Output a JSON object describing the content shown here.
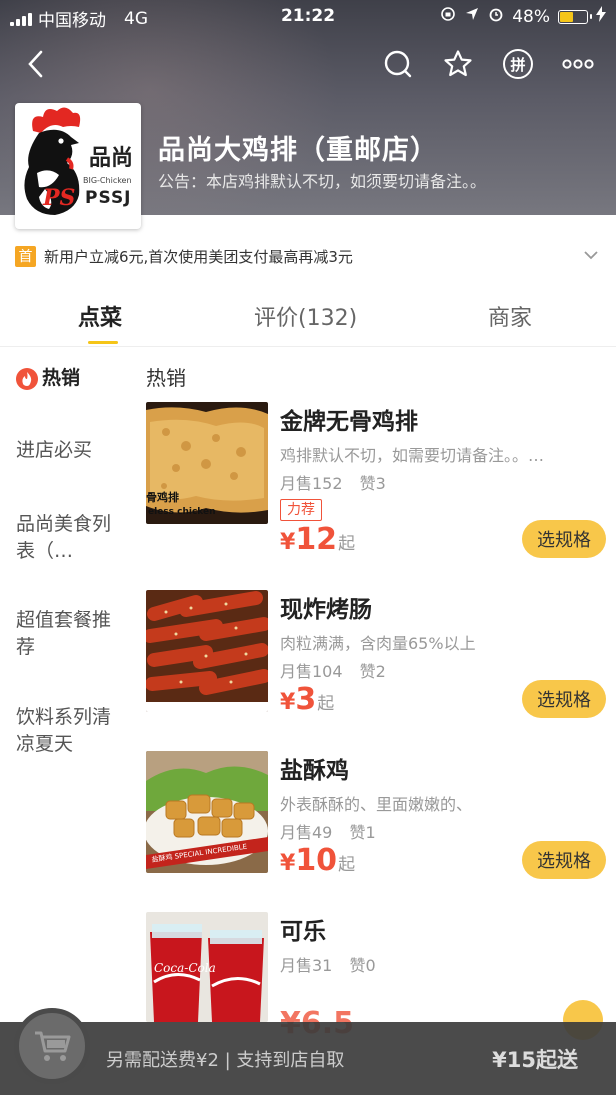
{
  "status": {
    "carrier": "中国移动",
    "network": "4G",
    "time": "21:22",
    "battery_pct": "48%",
    "battery_level": 0.48
  },
  "shop": {
    "name": "品尚大鸡排（重邮店）",
    "notice": "公告：本店鸡排默认不切，如须要切请备注。。",
    "logo_text_cn": "品尚",
    "logo_text_en": "PSSJ",
    "logo_text_small": "BIG-Chicken"
  },
  "promo": {
    "badge": "首",
    "text": "新用户立减6元,首次使用美团支付最高再减3元"
  },
  "tabs": [
    {
      "label": "点菜"
    },
    {
      "label": "评价(132)"
    },
    {
      "label": "商家"
    }
  ],
  "sidebar": {
    "items": [
      {
        "label": "热销"
      },
      {
        "label": "进店必买"
      },
      {
        "label": "品尚美食列表（…"
      },
      {
        "label": "超值套餐推荐"
      },
      {
        "label": "饮料系列清凉夏天"
      }
    ]
  },
  "section_title": "热销",
  "items": [
    {
      "name": "金牌无骨鸡排",
      "desc": "鸡排默认不切，如需要切请备注。。…",
      "sales": "月售152",
      "likes": "赞3",
      "tag": "力荐",
      "currency": "¥",
      "price": "12",
      "price_suffix": "起",
      "button": "选规格",
      "thumb_text_cn": "骨鸡排",
      "thumb_text_en": "eless chicken"
    },
    {
      "name": "现炸烤肠",
      "desc": "肉粒满满，含肉量65%以上",
      "sales": "月售104",
      "likes": "赞2",
      "currency": "¥",
      "price": "3",
      "price_suffix": "起",
      "button": "选规格"
    },
    {
      "name": "盐酥鸡",
      "desc": "外表酥酥的、里面嫩嫩的、",
      "sales": "月售49",
      "likes": "赞1",
      "currency": "¥",
      "price": "10",
      "price_suffix": "起",
      "button": "选规格",
      "thumb_text": "盐酥鸡 SPECIAL INCREDIBLE"
    },
    {
      "name": "可乐",
      "sales": "月售31",
      "likes": "赞0",
      "price_peek": "¥6.5",
      "thumb_text": "Coca-Cola"
    }
  ],
  "cart": {
    "text": "另需配送费¥2 | 支持到店自取",
    "min_order": "¥15起送"
  },
  "colors": {
    "accent": "#f8c74a",
    "price": "#f0533a",
    "header_bg": "#55555f"
  }
}
